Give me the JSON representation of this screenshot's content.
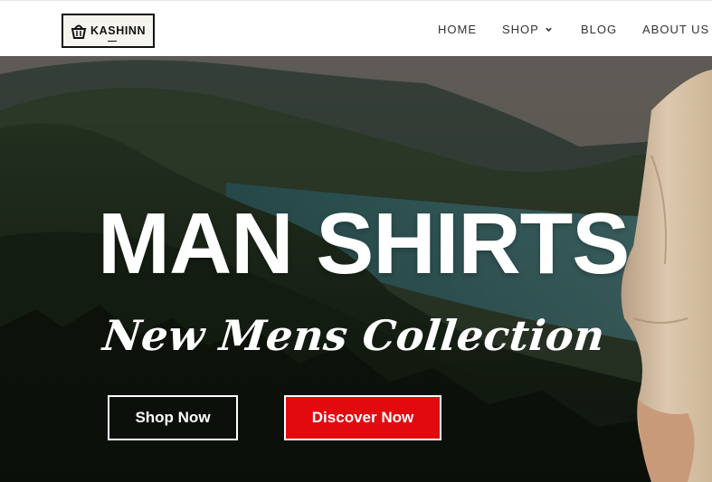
{
  "brand": {
    "logo_text": "KASHINN"
  },
  "nav": {
    "items": [
      {
        "label": "HOME"
      },
      {
        "label": "SHOP"
      },
      {
        "label": "BLOG"
      },
      {
        "label": "ABOUT US"
      }
    ]
  },
  "hero": {
    "headline": "MAN SHIRTS",
    "subheadline": "New Mens Collection",
    "buttons": {
      "shop_now": "Shop Now",
      "discover_now": "Discover Now"
    }
  },
  "colors": {
    "accent_red": "#e30a0f",
    "header_bg": "#ffffff",
    "nav_text": "#333333",
    "forest_dark": "#1f2a1d",
    "water": "#3f6f72"
  },
  "icons": {
    "logo": "basket-icon",
    "shop_dropdown": "chevron-down-icon"
  }
}
